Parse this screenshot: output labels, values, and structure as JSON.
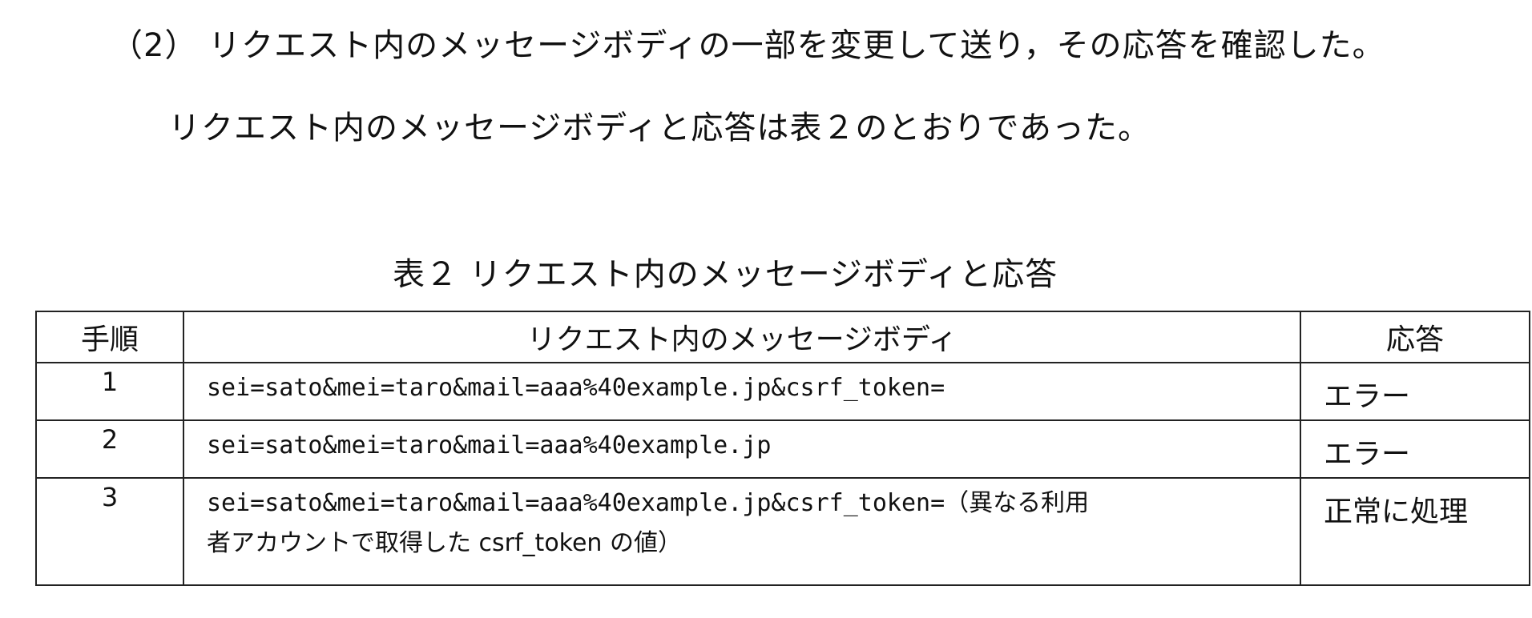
{
  "paragraph": {
    "line1": "（2） リクエスト内のメッセージボディの一部を変更して送り，その応答を確認した。",
    "line2": "リクエスト内のメッセージボディと応答は表２のとおりであった。"
  },
  "table": {
    "caption": "表２ リクエスト内のメッセージボディと応答",
    "headers": {
      "step": "手順",
      "body": "リクエスト内のメッセージボディ",
      "response": "応答"
    },
    "rows": [
      {
        "step": "1",
        "body_line1": "sei=sato&mei=taro&mail=aaa%40example.jp&csrf_token=",
        "body_line2": "",
        "response": "エラー"
      },
      {
        "step": "2",
        "body_line1": "sei=sato&mei=taro&mail=aaa%40example.jp",
        "body_line2": "",
        "response": "エラー"
      },
      {
        "step": "3",
        "body_line1": "sei=sato&mei=taro&mail=aaa%40example.jp&csrf_token=（異なる利用",
        "body_line2": "者アカウントで取得した csrf_token の値）",
        "response": "正常に処理"
      }
    ]
  }
}
